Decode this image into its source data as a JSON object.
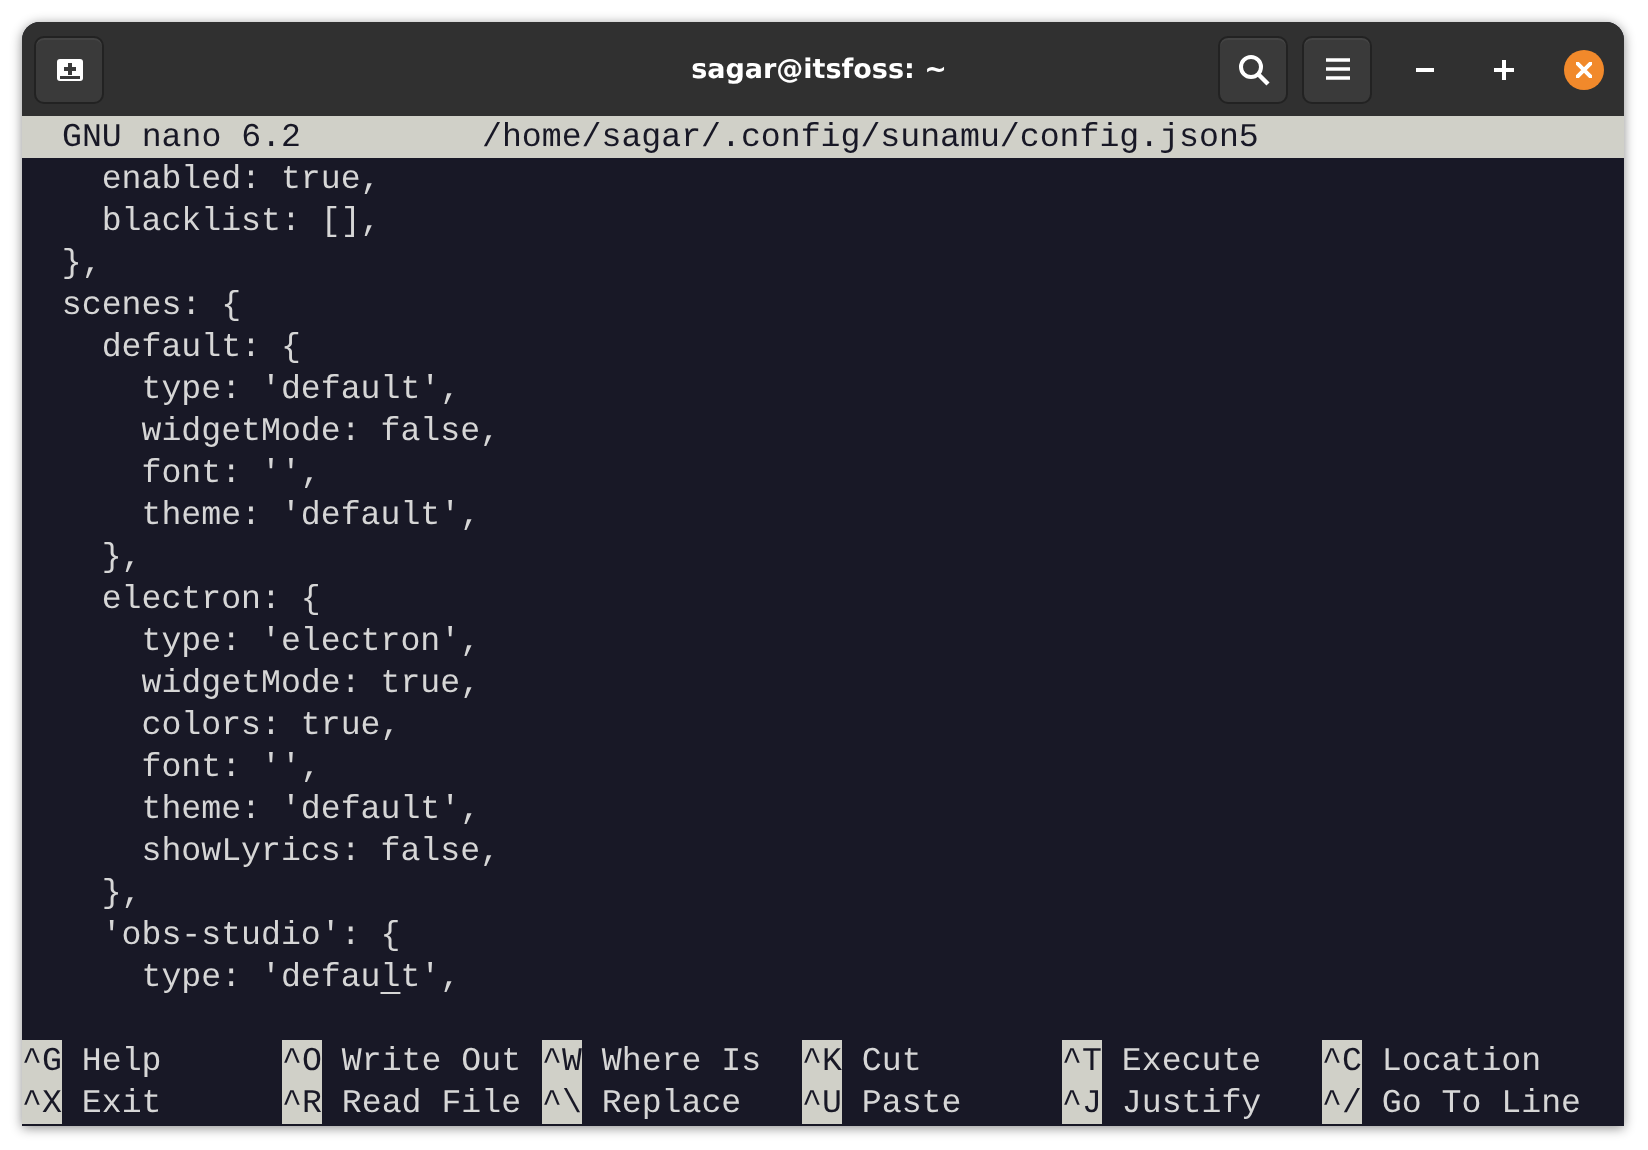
{
  "window": {
    "title": "sagar@itsfoss: ~"
  },
  "nano": {
    "version": "GNU nano 6.2",
    "file": "/home/sagar/.config/sunamu/config.json5"
  },
  "lines": [
    "    enabled: true,",
    "    blacklist: [],",
    "  },",
    "  scenes: {",
    "    default: {",
    "      type: 'default',",
    "      widgetMode: false,",
    "      font: '',",
    "      theme: 'default',",
    "    },",
    "    electron: {",
    "      type: 'electron',",
    "      widgetMode: true,",
    "      colors: true,",
    "      font: '',",
    "      theme: 'default',",
    "      showLyrics: false,",
    "    },",
    "    'obs-studio': {",
    {
      "before": "      type: 'defau",
      "cursor": "l",
      "after": "t',"
    }
  ],
  "shortcuts": [
    [
      {
        "key": "^G",
        "label": "Help"
      },
      {
        "key": "^X",
        "label": "Exit"
      }
    ],
    [
      {
        "key": "^O",
        "label": "Write Out"
      },
      {
        "key": "^R",
        "label": "Read File"
      }
    ],
    [
      {
        "key": "^W",
        "label": "Where Is"
      },
      {
        "key": "^\\",
        "label": "Replace"
      }
    ],
    [
      {
        "key": "^K",
        "label": "Cut"
      },
      {
        "key": "^U",
        "label": "Paste"
      }
    ],
    [
      {
        "key": "^T",
        "label": "Execute"
      },
      {
        "key": "^J",
        "label": "Justify"
      }
    ],
    [
      {
        "key": "^C",
        "label": "Location"
      },
      {
        "key": "^/",
        "label": "Go To Line"
      }
    ]
  ]
}
